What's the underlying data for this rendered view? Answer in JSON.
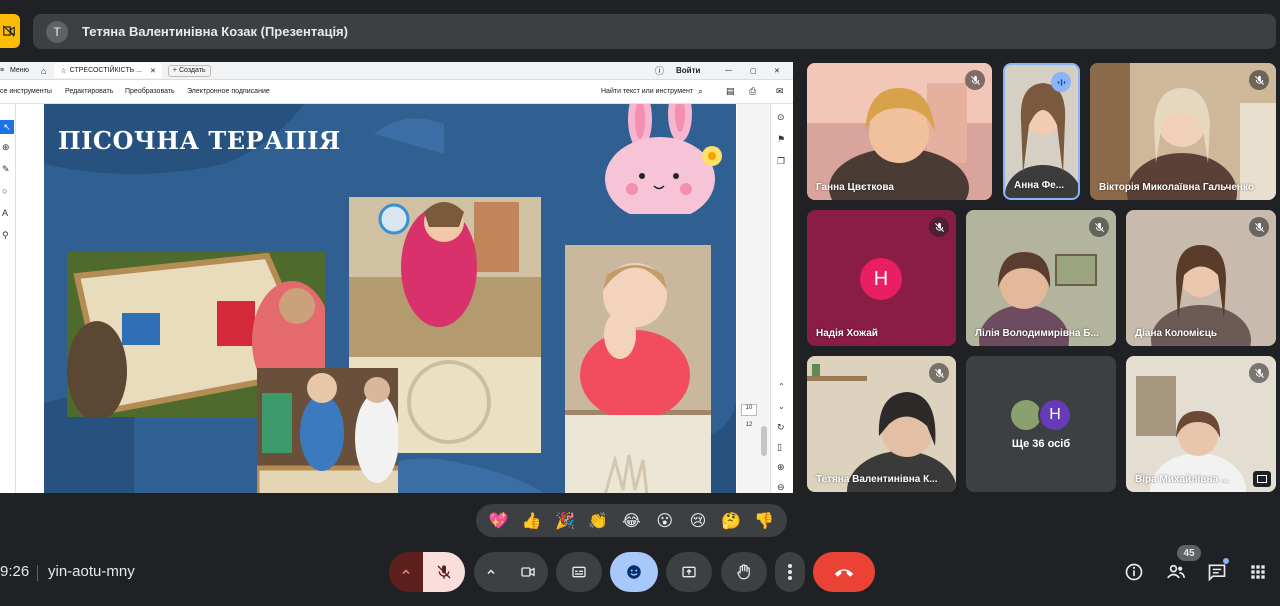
{
  "top_bar": {
    "presenter_initial": "T",
    "presenter_label": "Тетяна Валентинівна Козак (Презентація)"
  },
  "shared_screen": {
    "browser": {
      "menu_label": "Меню",
      "tab_title": "СТРЕСОСТІЙКІСТЬ ...",
      "new_tab_label": "Создать",
      "signin_label": "Войти"
    },
    "pdf_toolbar": {
      "tools": [
        "се инструменты",
        "Редактировать",
        "Преобразовать",
        "Электронное подписание"
      ],
      "search_label": "Найти текст или инструмент"
    },
    "page_numbers": [
      "10",
      "12"
    ],
    "slide": {
      "title": "ПІСОЧНА ТЕРАПІЯ"
    }
  },
  "participants": [
    {
      "name": "Ганна Цвєткова",
      "muted": true
    },
    {
      "name": "Анна Фе...",
      "muted": false,
      "speaking": true
    },
    {
      "name": "Вікторія Миколаївна Гальченко",
      "muted": true
    },
    {
      "name": "Надія Хожай",
      "initial": "H",
      "muted": true
    },
    {
      "name": "Лілія Володимирівна Б...",
      "muted": true
    },
    {
      "name": "Діана Коломієць",
      "muted": true
    },
    {
      "name": "Тетяна Валентинівна К...",
      "muted": true
    },
    {
      "name": "Віра Михайлівна ...",
      "muted": true
    }
  ],
  "others_tile": {
    "initial": "H",
    "label": "Ще 36 осіб"
  },
  "reactions": [
    "💖",
    "👍",
    "🎉",
    "👏",
    "😂",
    "😮",
    "😢",
    "🤔",
    "👎"
  ],
  "bottom_bar": {
    "time": "9:26",
    "meeting_code": "yin-aotu-mny",
    "people_count": "45"
  },
  "colors": {
    "background": "#202124",
    "mic_off_red": "#f28b82",
    "end_call_red": "#ea4335",
    "active_blue": "#8ab4f8",
    "slide_blue": "#2e5d8f",
    "avatar_pink": "#e91e63",
    "avatar_purple": "#673ab7"
  }
}
